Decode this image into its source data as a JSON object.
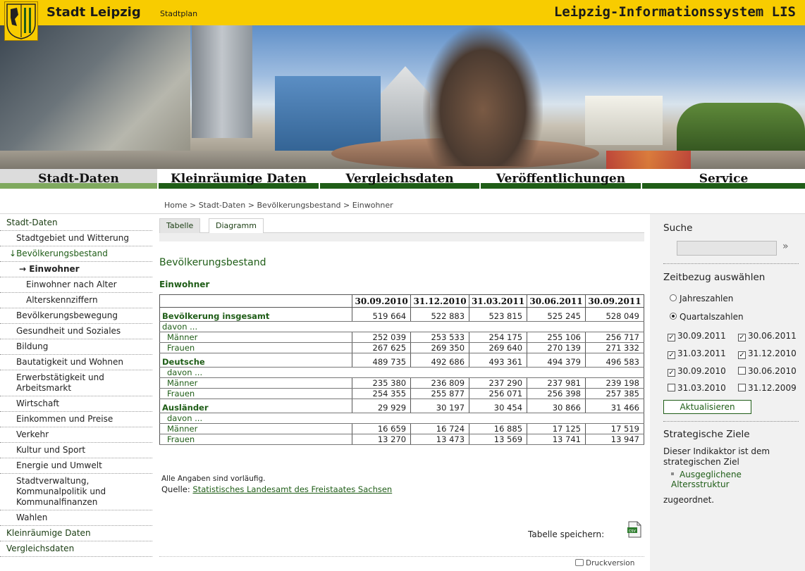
{
  "header": {
    "brand": "Stadt Leipzig",
    "stadtplan_link": "Stadtplan",
    "system_title": "Leipzig-Informationssystem LIS",
    "accent_color": "#f8cc00"
  },
  "mainnav": {
    "items": [
      {
        "label": "Stadt-Daten"
      },
      {
        "label": "Kleinräumige Daten"
      },
      {
        "label": "Vergleichsdaten"
      },
      {
        "label": "Veröffentlichungen"
      },
      {
        "label": "Service"
      }
    ],
    "active": "Stadt-Daten",
    "brand_green": "#1f5d17"
  },
  "breadcrumb": {
    "items": [
      "Home",
      "Stadt-Daten",
      "Bevölkerungsbestand",
      "Einwohner"
    ],
    "sep": ">"
  },
  "sidebar": {
    "items": [
      {
        "label": "Stadt-Daten"
      },
      {
        "label": "Stadtgebiet und Witterung"
      },
      {
        "label": "Bevölkerungsbestand",
        "prefix": "↓"
      },
      {
        "label": "Einwohner",
        "prefix": "→"
      },
      {
        "label": "Einwohner nach Alter"
      },
      {
        "label": "Alterskennziffern"
      },
      {
        "label": "Bevölkerungsbewegung"
      },
      {
        "label": "Gesundheit und Soziales"
      },
      {
        "label": "Bildung"
      },
      {
        "label": "Bautatigkeit und Wohnen"
      },
      {
        "label": "Erwerbstätigkeit und Arbeitsmarkt"
      },
      {
        "label": "Wirtschaft"
      },
      {
        "label": "Einkommen und Preise"
      },
      {
        "label": "Verkehr"
      },
      {
        "label": "Kultur und Sport"
      },
      {
        "label": "Energie und Umwelt"
      },
      {
        "label": "Stadtverwaltung, Kommunalpolitik und Kommunalfinanzen"
      },
      {
        "label": "Wahlen"
      },
      {
        "label": "Kleinräumige Daten"
      },
      {
        "label": "Vergleichsdaten"
      }
    ]
  },
  "content": {
    "tabs": [
      {
        "label": "Tabelle"
      },
      {
        "label": "Diagramm"
      }
    ],
    "active_tab": "Tabelle",
    "section_title": "Bevölkerungsbestand",
    "table_title": "Einwohner",
    "table": {
      "columns": [
        "30.09.2010",
        "31.12.2010",
        "31.03.2011",
        "30.06.2011",
        "30.09.2011"
      ],
      "rows": [
        {
          "label": "Bevölkerung insgesamt",
          "values": [
            "519 664",
            "522 883",
            "523 815",
            "525 245",
            "528 049"
          ]
        },
        {
          "label": "davon ..."
        },
        {
          "label": "Männer",
          "values": [
            "252 039",
            "253 533",
            "254 175",
            "255 106",
            "256 717"
          ]
        },
        {
          "label": "Frauen",
          "values": [
            "267 625",
            "269 350",
            "269 640",
            "270 139",
            "271 332"
          ]
        },
        {
          "label": "Deutsche",
          "values": [
            "489 735",
            "492 686",
            "493 361",
            "494 379",
            "496 583"
          ]
        },
        {
          "label": "davon ..."
        },
        {
          "label": "Männer",
          "values": [
            "235 380",
            "236 809",
            "237 290",
            "237 981",
            "239 198"
          ]
        },
        {
          "label": "Frauen",
          "values": [
            "254 355",
            "255 877",
            "256 071",
            "256 398",
            "257 385"
          ]
        },
        {
          "label": "Ausländer",
          "values": [
            "29 929",
            "30 197",
            "30 454",
            "30 866",
            "31 466"
          ]
        },
        {
          "label": "davon ..."
        },
        {
          "label": "Männer",
          "values": [
            "16 659",
            "16 724",
            "16 885",
            "17 125",
            "17 519"
          ]
        },
        {
          "label": "Frauen",
          "values": [
            "13 270",
            "13 473",
            "13 569",
            "13 741",
            "13 947"
          ]
        }
      ]
    },
    "note": "Alle Angaben sind vorläufig.",
    "source_label": "Quelle:",
    "source_link": "Statistisches Landesamt des Freistaates Sachsen",
    "save_label": "Tabelle speichern:",
    "print_label": "Druckversion"
  },
  "rightbar": {
    "search_title": "Suche",
    "search_value": "",
    "search_go": "»",
    "zeit_title": "Zeitbezug auswählen",
    "radios": [
      {
        "label": "Jahreszahlen",
        "checked": false
      },
      {
        "label": "Quartalszahlen",
        "checked": true
      }
    ],
    "checkboxes": [
      {
        "label": "30.09.2011",
        "checked": true
      },
      {
        "label": "30.06.2011",
        "checked": true
      },
      {
        "label": "31.03.2011",
        "checked": true
      },
      {
        "label": "31.12.2010",
        "checked": true
      },
      {
        "label": "30.09.2010",
        "checked": true
      },
      {
        "label": "30.06.2010",
        "checked": false
      },
      {
        "label": "31.03.2010",
        "checked": false
      },
      {
        "label": "31.12.2009",
        "checked": false
      }
    ],
    "refresh_label": "Aktualisieren",
    "ziele_title": "Strategische Ziele",
    "ziele_text_1": "Dieser Indikaktor ist dem strategischen Ziel",
    "ziele_bullet": "Ausgeglichene Altersstruktur",
    "ziele_text_2": "zugeordnet."
  }
}
